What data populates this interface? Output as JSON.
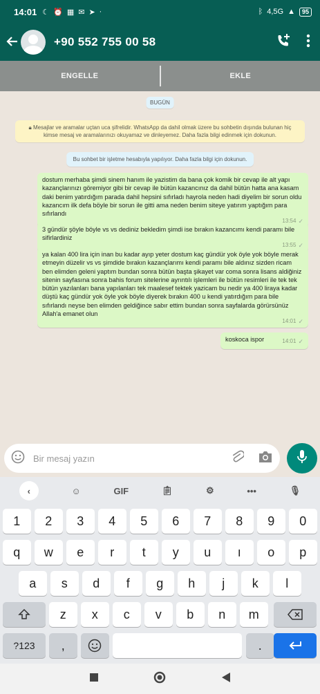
{
  "status_bar": {
    "time": "14:01",
    "network": "4,5G",
    "battery": "95"
  },
  "header": {
    "title": "+90 552 755 00 58"
  },
  "actions": {
    "block": "ENGELLE",
    "add": "EKLE"
  },
  "chat": {
    "date_chip": "BUGÜN",
    "encryption_note": "Mesajlar ve aramalar uçtan uca şifrelidir. WhatsApp da dahil olmak üzere bu sohbetin dışında bulunan hiç kimse mesaj ve aramalarınızı okuyamaz ve dinleyemez. Daha fazla bilgi edinmek için dokunun.",
    "business_note": "Bu sohbet bir işletme hesabıyla yapılıyor. Daha fazla bilgi için dokunun.",
    "messages": [
      {
        "text": "dostum merhaba şimdi sinem hanım ile yazistim da bana çok komik bir cevap ile alt yapı kazançlarınızı göremiyor gibi bir cevap ile bütün kazancınız da dahil bütün hatta ana kasam daki benim yatırdığım parada dahil hepsini sıfırladı hayrola neden hadi diyelim bir sorun oldu kazancım ilk defa böyle bir sorun ile gitti ama neden benim siteye yatırım yaptığım para sıfırlandı",
        "time": "13:54"
      },
      {
        "text": "3 gündür şöyle böyle vs vs dediniz bekledim şimdi ise bırakın kazancımı kendi paramı bile sifirlardiniz",
        "time": "13:55"
      },
      {
        "text": "ya kalan 400 lira için inan bu kadar ayıp yeter dostum kaç gündür yok öyle yok böyle merak etmeyin düzelir vs vs şimdide bırakın kazançlarımı kendi paramı bile aldınız sizden ricam ben elimden geleni yaptım bundan sonra bütün başta şikayet var coma sonra lisans aldiğiniz sitenin sayfasına sonra bahis forum sitelerine ayrıntılı işlemleri ile bütün resimleri ile tek tek bütün yazılanları bana yapılanları tek maalesef tektek yazicam bu nedir ya 400 liraya kadar düştü kaç gündür yok öyle yok böyle diyerek bırakın 400 u kendi yatırdığım para bile sıfırlandı neyse ben elimden geldiğince sabır ettim bundan sonra sayfalarda görürsünüz Allah'a emanet olun",
        "time": "14:01"
      },
      {
        "text": "koskoca ispor",
        "time": "14:01"
      }
    ]
  },
  "composer": {
    "placeholder": "Bir mesaj yazın"
  },
  "keyboard": {
    "gif": "GIF",
    "numbers": [
      "1",
      "2",
      "3",
      "4",
      "5",
      "6",
      "7",
      "8",
      "9",
      "0"
    ],
    "row1": [
      "q",
      "w",
      "e",
      "r",
      "t",
      "y",
      "u",
      "ı",
      "o",
      "p"
    ],
    "row2": [
      "a",
      "s",
      "d",
      "f",
      "g",
      "h",
      "j",
      "k",
      "l"
    ],
    "row3": [
      "z",
      "x",
      "c",
      "v",
      "b",
      "n",
      "m"
    ],
    "symbols": "?123",
    "comma": ",",
    "period": "."
  }
}
